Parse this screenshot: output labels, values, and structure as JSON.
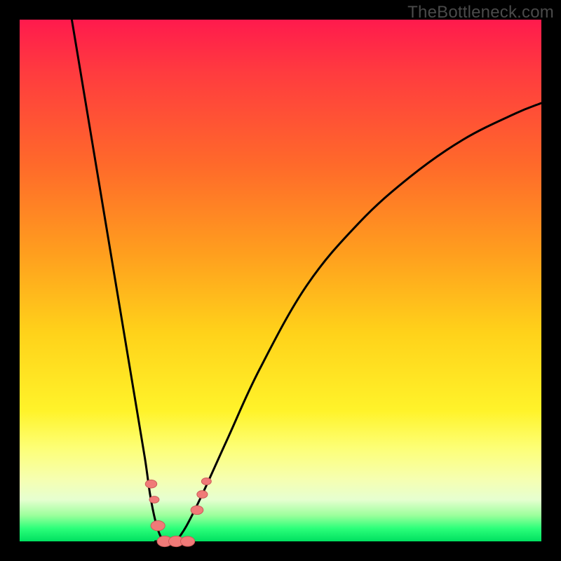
{
  "watermark": "TheBottleneck.com",
  "chart_data": {
    "type": "line",
    "title": "",
    "xlabel": "",
    "ylabel": "",
    "x_range": [
      0,
      100
    ],
    "y_range": [
      0,
      100
    ],
    "grid": false,
    "series": [
      {
        "name": "left-branch",
        "x": [
          10,
          12,
          14,
          16,
          18,
          20,
          22,
          24,
          25,
          26,
          27,
          28
        ],
        "y": [
          100,
          88,
          76,
          64,
          52,
          40,
          28,
          16,
          9,
          4,
          1,
          0
        ]
      },
      {
        "name": "right-branch",
        "x": [
          30,
          32,
          35,
          40,
          46,
          55,
          65,
          75,
          85,
          95,
          100
        ],
        "y": [
          0,
          3,
          9,
          20,
          33,
          49,
          61,
          70,
          77,
          82,
          84
        ]
      },
      {
        "name": "floor-segment",
        "x": [
          26,
          32
        ],
        "y": [
          0,
          0
        ]
      }
    ],
    "markers": [
      {
        "name": "left-marker-high",
        "x": 25.2,
        "y": 11,
        "r": 1.3
      },
      {
        "name": "left-marker-mid",
        "x": 25.8,
        "y": 8,
        "r": 1.1
      },
      {
        "name": "left-marker-low",
        "x": 26.5,
        "y": 3,
        "r": 1.6
      },
      {
        "name": "floor-marker-a",
        "x": 27.8,
        "y": 0,
        "r": 1.7
      },
      {
        "name": "floor-marker-b",
        "x": 30.0,
        "y": 0,
        "r": 1.7
      },
      {
        "name": "floor-marker-c",
        "x": 32.2,
        "y": 0,
        "r": 1.6
      },
      {
        "name": "right-marker-low",
        "x": 34.0,
        "y": 6,
        "r": 1.4
      },
      {
        "name": "right-marker-mid",
        "x": 35.0,
        "y": 9,
        "r": 1.2
      },
      {
        "name": "right-marker-hi",
        "x": 35.8,
        "y": 11.5,
        "r": 1.1
      }
    ],
    "colors": {
      "curve": "#000000",
      "marker_fill": "#f07a78",
      "marker_stroke": "#cc5a58",
      "gradient_top": "#ff1a4d",
      "gradient_bottom": "#00e060"
    }
  }
}
